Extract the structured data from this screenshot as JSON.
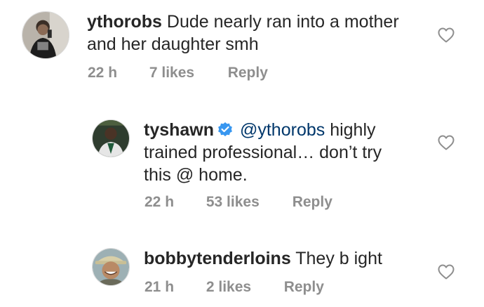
{
  "comments": [
    {
      "username": "ythorobs",
      "text_line1": "Dude nearly ran into a mother",
      "text_line2": "and her daughter smh",
      "time": "22 h",
      "likes": "7 likes",
      "reply": "Reply",
      "like_icon": "heart-outline-icon"
    },
    {
      "username": "tyshawn",
      "verified_icon": "verified-badge-icon",
      "mention": "@ythorobs",
      "text_line1": " highly",
      "text_line2": "trained professional… don’t try",
      "text_line3": "this @ home.",
      "time": "22 h",
      "likes": "53 likes",
      "reply": "Reply",
      "like_icon": "heart-outline-icon"
    },
    {
      "username": "bobbytenderloins",
      "text_line1": "They b ight",
      "time": "21 h",
      "likes": "2 likes",
      "reply": "Reply",
      "like_icon": "heart-outline-icon"
    }
  ],
  "colors": {
    "text": "#262626",
    "secondary": "#8e8e8e",
    "mention": "#00376b",
    "verified": "#3897f0"
  }
}
